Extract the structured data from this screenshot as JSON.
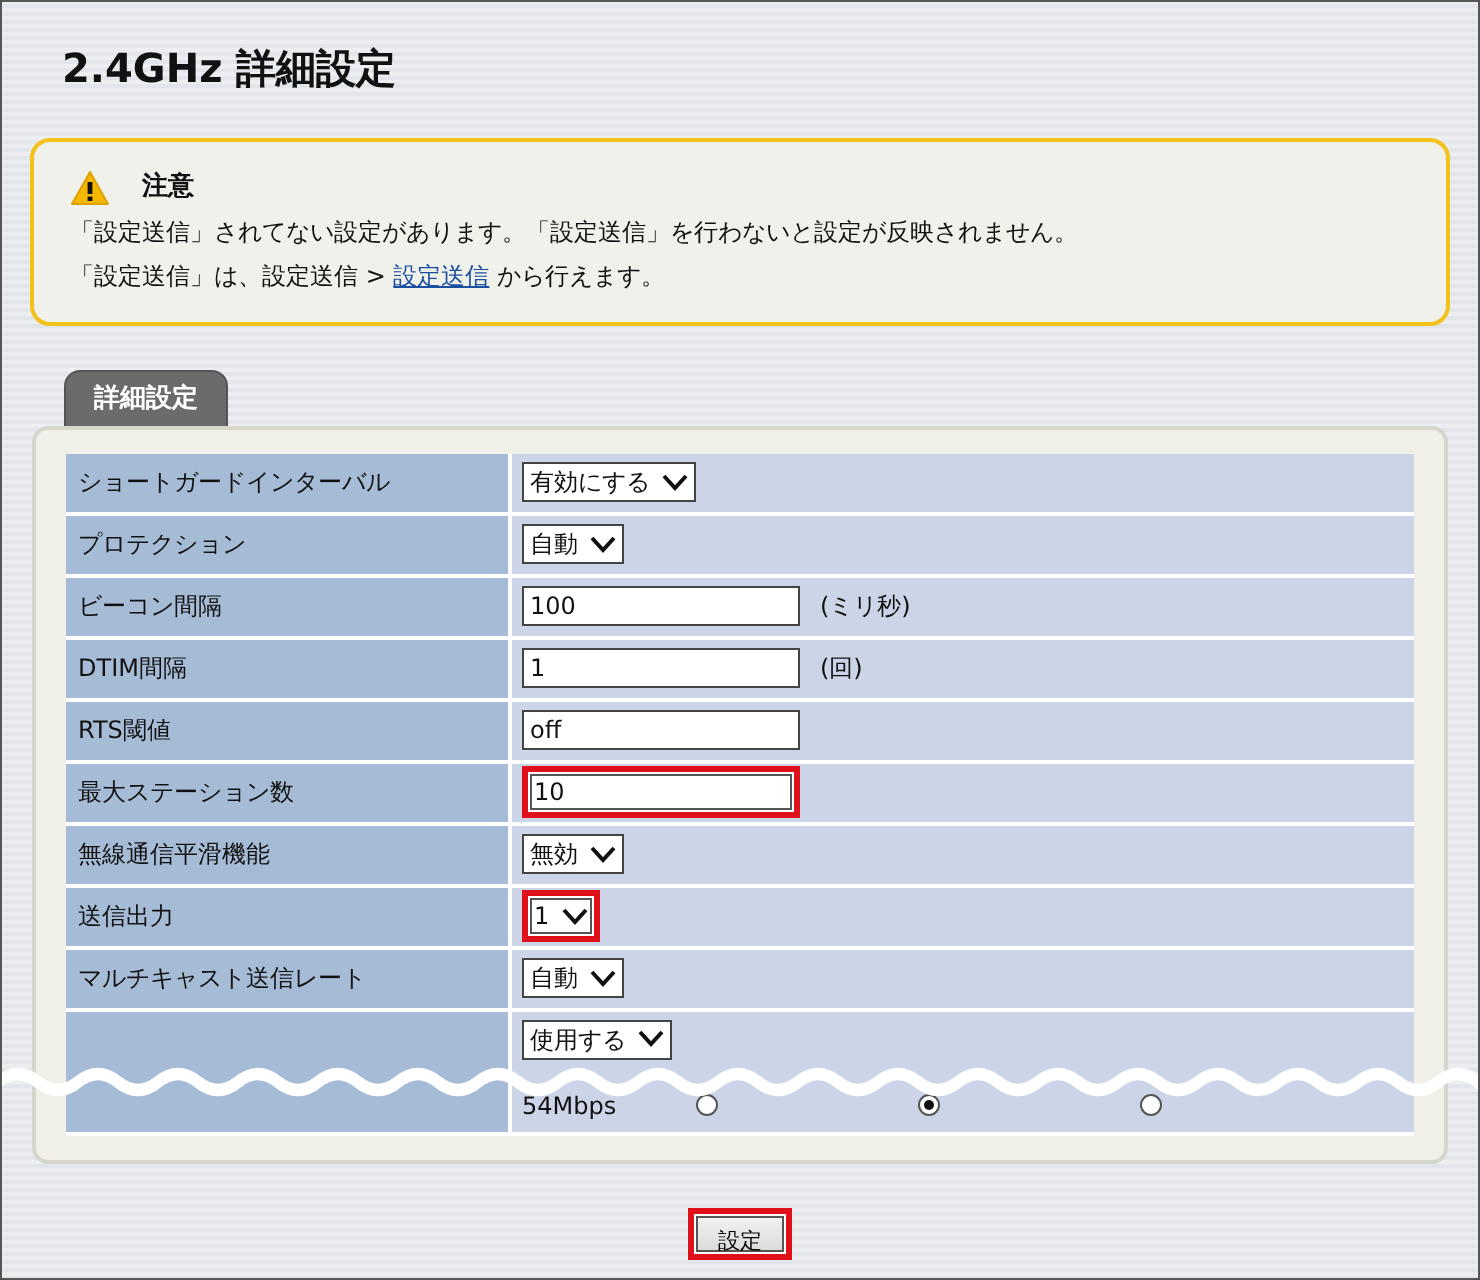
{
  "title": "2.4GHz 詳細設定",
  "notice": {
    "heading": "注意",
    "line_1": "「設定送信」されてない設定があります。「設定送信」を行わないと設定が反映されません。",
    "line_2_before": "「設定送信」は、設定送信 > ",
    "line_2_link": "設定送信",
    "line_2_after": " から行えます。"
  },
  "tab": {
    "label": "詳細設定",
    "selected": true
  },
  "rows": [
    {
      "label": "ショートガードインターバル",
      "kind": "select",
      "value": "有効にする",
      "highlighted": false
    },
    {
      "label": "プロテクション",
      "kind": "select",
      "value": "自動",
      "highlighted": false
    },
    {
      "label": "ビーコン間隔",
      "kind": "text",
      "value": "100",
      "unit": "(ミリ秒)",
      "highlighted": false
    },
    {
      "label": "DTIM間隔",
      "kind": "text",
      "value": "1",
      "unit": "(回)",
      "highlighted": false
    },
    {
      "label": "RTS閾値",
      "kind": "text",
      "value": "off",
      "highlighted": false
    },
    {
      "label": "最大ステーション数",
      "kind": "text",
      "value": "10",
      "highlighted": true
    },
    {
      "label": "無線通信平滑機能",
      "kind": "select",
      "value": "無効",
      "highlighted": false
    },
    {
      "label": "送信出力",
      "kind": "select",
      "value": "1",
      "highlighted": true
    },
    {
      "label": "マルチキャスト送信レート",
      "kind": "select",
      "value": "自動",
      "highlighted": false
    },
    {
      "kind": "torn",
      "value": "使用する",
      "rate": "54Mbps",
      "radios": [
        {
          "selected": false
        },
        {
          "selected": true
        },
        {
          "selected": false
        }
      ]
    }
  ],
  "submit": {
    "label": "設定",
    "highlighted": true
  }
}
